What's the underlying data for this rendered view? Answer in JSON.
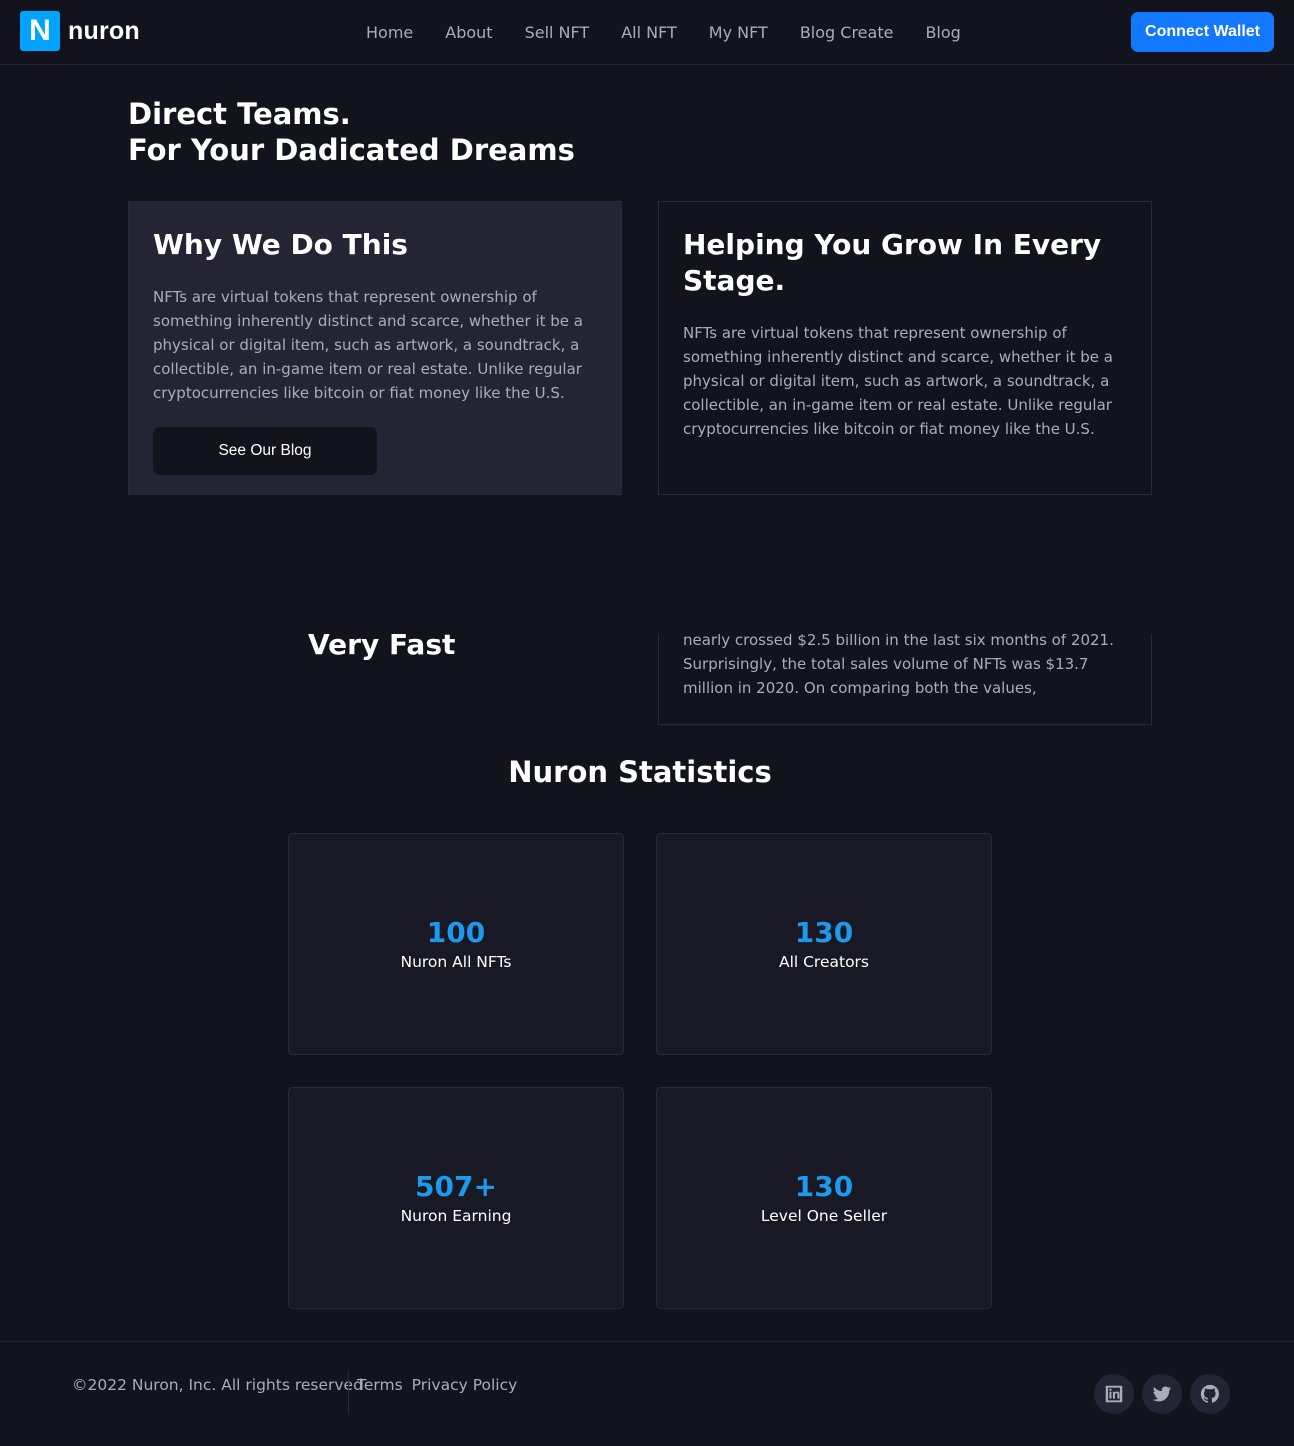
{
  "brand": {
    "badge": "N",
    "name": "nuron"
  },
  "nav": {
    "items": [
      {
        "label": "Home"
      },
      {
        "label": "About"
      },
      {
        "label": "Sell NFT"
      },
      {
        "label": "All NFT"
      },
      {
        "label": "My NFT"
      },
      {
        "label": "Blog Create"
      },
      {
        "label": "Blog"
      }
    ]
  },
  "header": {
    "connect_label": "Connect Wallet"
  },
  "hero": {
    "line1": "Direct Teams.",
    "line2": "For Your Dadicated Dreams"
  },
  "cards": [
    {
      "title": "Why We Do This",
      "text": "NFTs are virtual tokens that represent ownership of something inherently distinct and scarce, whether it be a physical or digital item, such as artwork, a soundtrack, a collectible, an in-game item or real estate. Unlike regular cryptocurrencies like bitcoin or fiat money like the U.S.",
      "button": "See Our Blog"
    },
    {
      "title": "Helping You Grow In Every Stage.",
      "text": "NFTs are virtual tokens that represent ownership of something inherently distinct and scarce, whether it be a physical or digital item, such as artwork, a soundtrack, a collectible, an in-game item or real estate. Unlike regular cryptocurrencies like bitcoin or fiat money like the U.S."
    }
  ],
  "partial": {
    "heading": "Very Fast",
    "text": "nearly crossed $2.5 billion in the last six months of 2021. Surprisingly, the total sales volume of NFTs was $13.7 million in 2020. On comparing both the values,"
  },
  "stats": {
    "title": "Nuron Statistics",
    "items": [
      {
        "value": "100",
        "label": "Nuron All NFTs"
      },
      {
        "value": "130",
        "label": "All Creators"
      },
      {
        "value": "507+",
        "label": "Nuron Earning"
      },
      {
        "value": "130",
        "label": "Level One Seller"
      }
    ]
  },
  "footer": {
    "copyright": "©2022 Nuron, Inc. All rights reserved",
    "links": [
      {
        "label": "Terms"
      },
      {
        "label": "Privacy Policy"
      }
    ],
    "socials": [
      "linkedin-icon",
      "twitter-icon",
      "github-icon"
    ]
  },
  "colors": {
    "background": "#13131d",
    "accent": "#1278ff",
    "stat_value": "#1b9aee",
    "card_bg": "#242435"
  }
}
